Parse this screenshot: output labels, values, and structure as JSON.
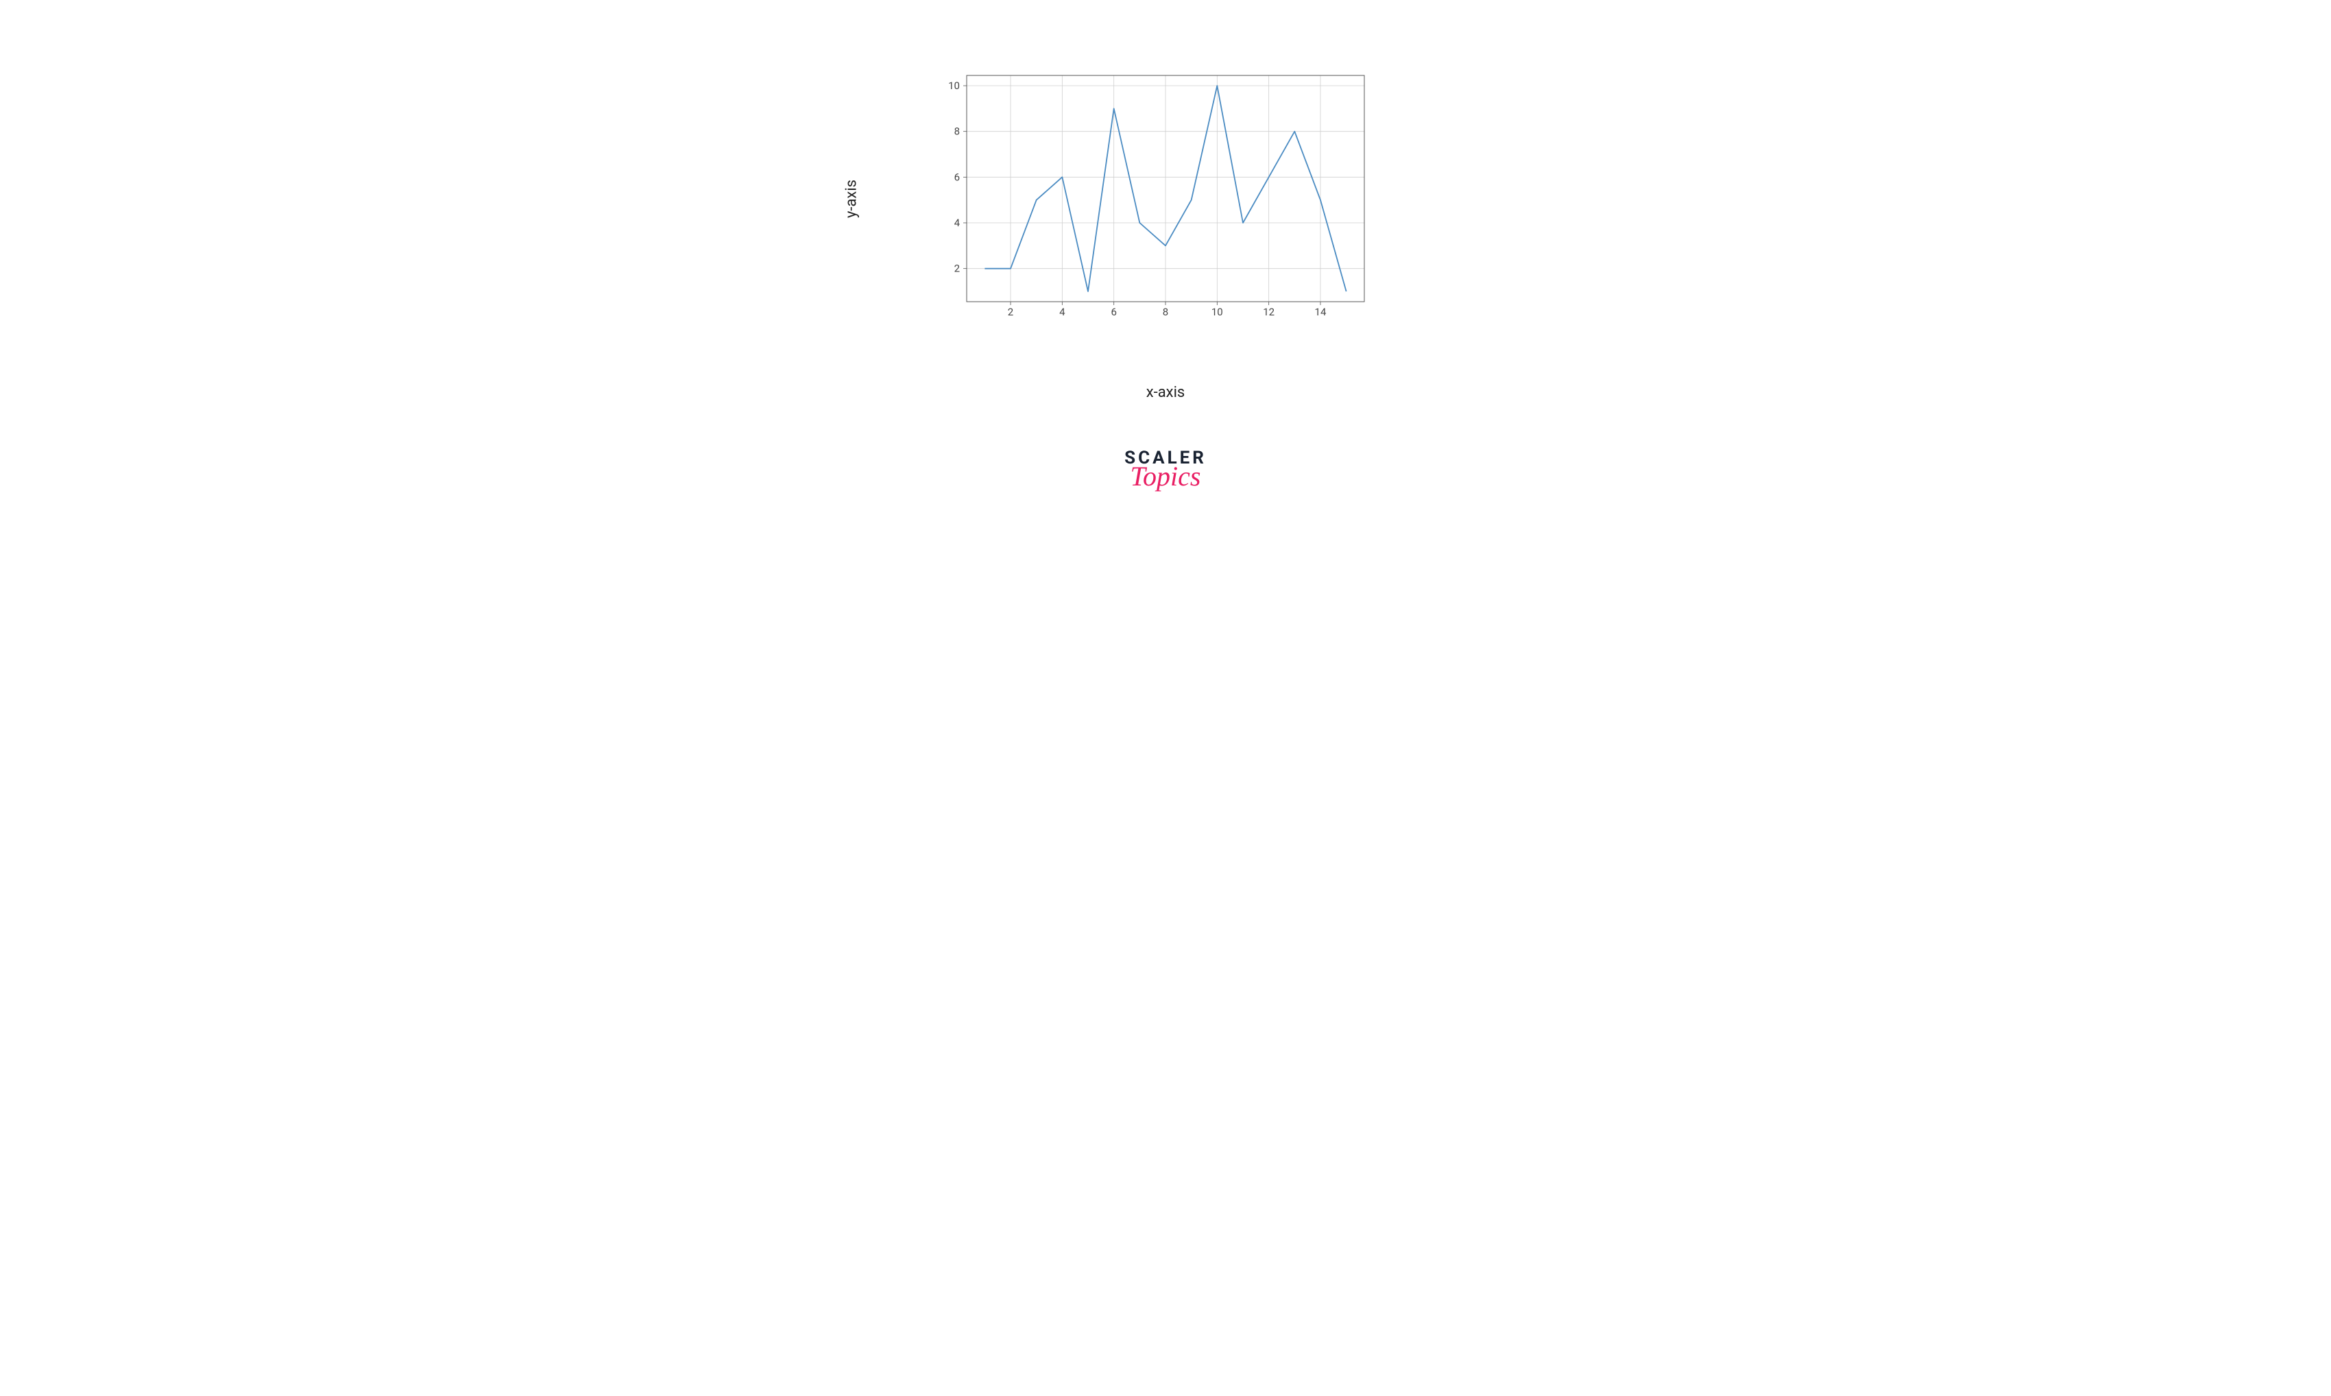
{
  "chart_data": {
    "type": "line",
    "x": [
      1,
      2,
      3,
      4,
      5,
      6,
      7,
      8,
      9,
      10,
      11,
      12,
      13,
      14,
      15
    ],
    "y": [
      2,
      2,
      5,
      6,
      1,
      9,
      4,
      3,
      5,
      10,
      4,
      6,
      8,
      5,
      1
    ],
    "xlabel": "x-axis",
    "ylabel": "y-axis",
    "xlim": [
      1,
      15
    ],
    "ylim": [
      1,
      10
    ],
    "xticks": [
      2,
      4,
      6,
      8,
      10,
      12,
      14
    ],
    "yticks": [
      2,
      4,
      6,
      8,
      10
    ],
    "grid": true,
    "line_color": "#4a8bc2"
  },
  "logo": {
    "word1": "SCALER",
    "word2": "Topics"
  }
}
